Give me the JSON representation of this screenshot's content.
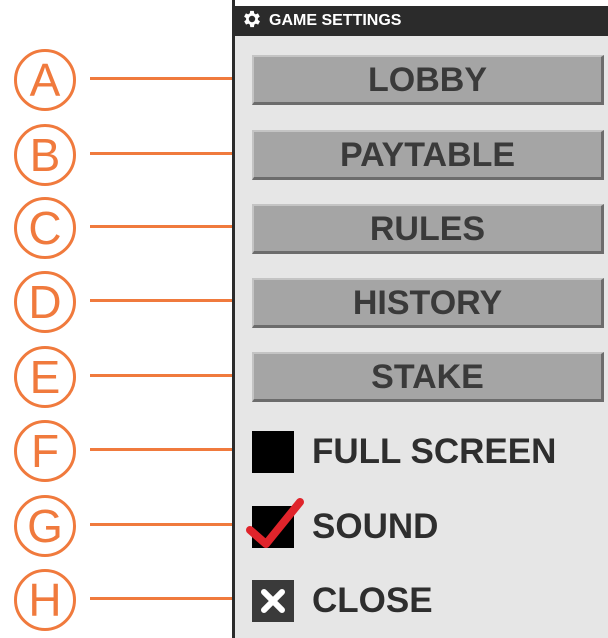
{
  "panel": {
    "title": "GAME SETTINGS",
    "title_icon": "gear-icon",
    "buttons": [
      {
        "label": "LOBBY",
        "callout": "A"
      },
      {
        "label": "PAYTABLE",
        "callout": "B"
      },
      {
        "label": "RULES",
        "callout": "C"
      },
      {
        "label": "HISTORY",
        "callout": "D"
      },
      {
        "label": "STAKE",
        "callout": "E"
      }
    ],
    "options": {
      "full_screen": {
        "label": "FULL SCREEN",
        "callout": "F",
        "checked": false
      },
      "sound": {
        "label": "SOUND",
        "callout": "G",
        "checked": true
      },
      "close": {
        "label": "CLOSE",
        "callout": "H",
        "icon": "close-icon"
      }
    }
  },
  "colors": {
    "annotation": "#f07a3d",
    "panel_bg": "#e6e6e6",
    "header_bg": "#2b2b2b",
    "button_bg": "#a5a5a5",
    "checkmark": "#e0242b"
  }
}
